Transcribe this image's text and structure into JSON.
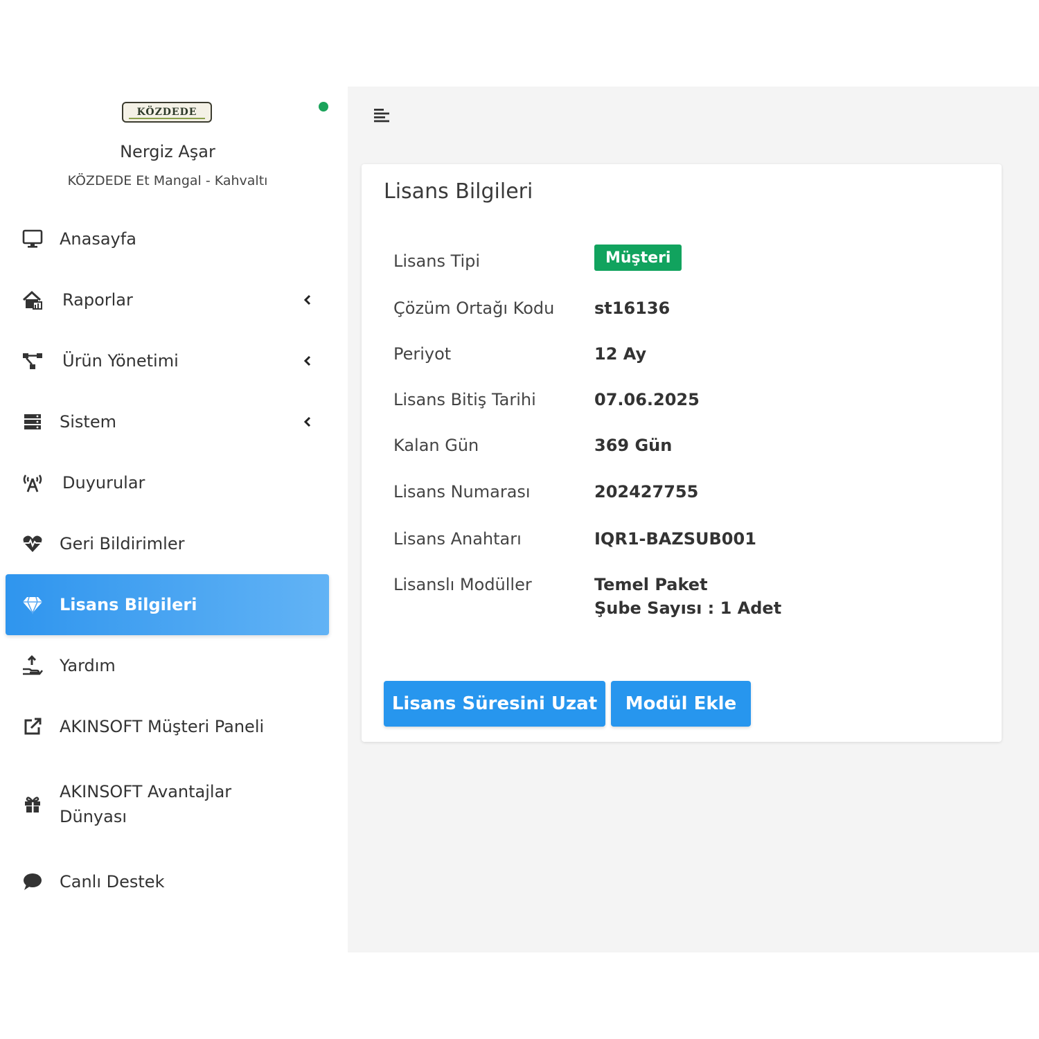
{
  "sidebar": {
    "logo_text": "KÖZDEDE",
    "user_name": "Nergiz Aşar",
    "company": "KÖZDEDE Et Mangal - Kahvaltı",
    "items": [
      {
        "label": "Anasayfa",
        "icon": "monitor-icon"
      },
      {
        "label": "Raporlar",
        "icon": "house-chart-icon",
        "has_submenu": true
      },
      {
        "label": "Ürün Yönetimi",
        "icon": "nodes-icon",
        "has_submenu": true
      },
      {
        "label": "Sistem",
        "icon": "server-icon",
        "has_submenu": true
      },
      {
        "label": "Duyurular",
        "icon": "broadcast-icon"
      },
      {
        "label": "Geri Bildirimler",
        "icon": "heart-pulse-icon"
      },
      {
        "label": "Lisans Bilgileri",
        "icon": "diamond-icon",
        "active": true
      },
      {
        "label": "Yardım",
        "icon": "hand-holding-icon"
      },
      {
        "label": "AKINSOFT Müşteri Paneli",
        "icon": "external-link-icon"
      },
      {
        "label": "AKINSOFT Avantajlar\nDünyası",
        "icon": "gift-icon"
      },
      {
        "label": "Canlı Destek",
        "icon": "chat-bubble-icon"
      }
    ]
  },
  "card": {
    "title": "Lisans Bilgileri",
    "rows": [
      {
        "key": "Lisans Tipi",
        "value": "Müşteri"
      },
      {
        "key": "Çözüm Ortağı Kodu",
        "value": "st16136"
      },
      {
        "key": "Periyot",
        "value": "12 Ay"
      },
      {
        "key": "Lisans Bitiş Tarihi",
        "value": "07.06.2025"
      },
      {
        "key": "Kalan Gün",
        "value": "369 Gün"
      },
      {
        "key": "Lisans Numarası",
        "value": "202427755"
      },
      {
        "key": "Lisans Anahtarı",
        "value": "IQR1-BAZSUB001"
      },
      {
        "key": "Lisanslı Modüller",
        "value": "Temel Paket",
        "value2": "Şube Sayısı : 1 Adet"
      }
    ],
    "buttons": {
      "extend": "Lisans Süresini Uzat",
      "add_module": "Modül Ekle"
    }
  },
  "colors": {
    "accent": "#2796ee",
    "badge_green": "#11a35e",
    "online": "#1aa35a",
    "main_bg": "#f4f4f4"
  }
}
